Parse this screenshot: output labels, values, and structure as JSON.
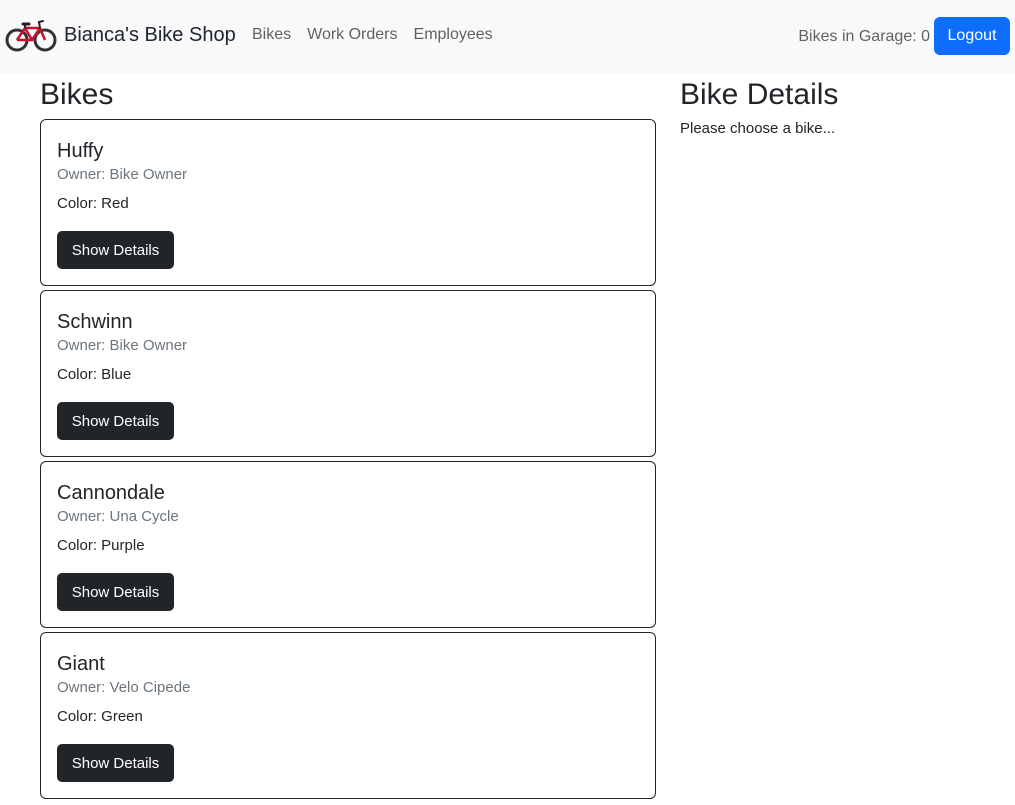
{
  "navbar": {
    "brand_icon": "bicycle-icon",
    "brand": "Bianca's Bike Shop",
    "links": [
      "Bikes",
      "Work Orders",
      "Employees"
    ],
    "garage_label": "Bikes in Garage: 0",
    "logout_label": "Logout",
    "logout_color": "#0d6efd"
  },
  "bikes": {
    "heading": "Bikes",
    "button_label": "Show Details",
    "items": [
      {
        "name": "Huffy",
        "owner": "Owner: Bike Owner",
        "color": "Color: Red"
      },
      {
        "name": "Schwinn",
        "owner": "Owner: Bike Owner",
        "color": "Color: Blue"
      },
      {
        "name": "Cannondale",
        "owner": "Owner: Una Cycle",
        "color": "Color: Purple"
      },
      {
        "name": "Giant",
        "owner": "Owner: Velo Cipede",
        "color": "Color: Green"
      }
    ]
  },
  "details": {
    "heading": "Bike Details",
    "message": "Please choose a bike..."
  }
}
